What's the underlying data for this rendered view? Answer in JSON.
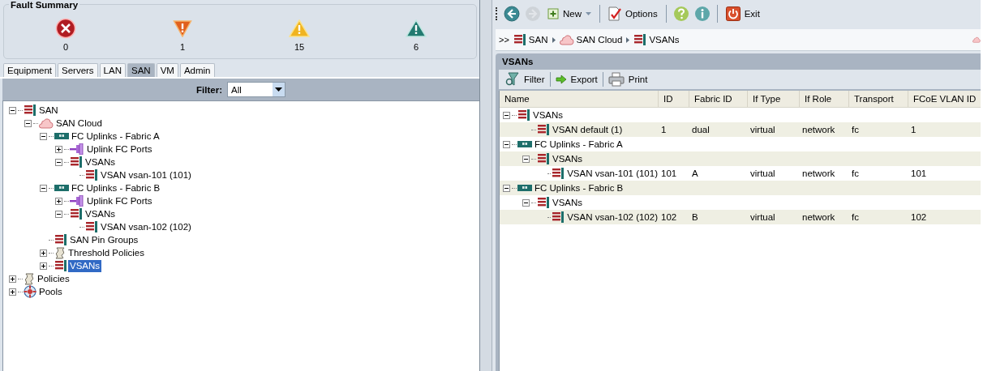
{
  "fault_summary": {
    "title": "Fault Summary",
    "faults": [
      {
        "kind": "critical",
        "count": "0"
      },
      {
        "kind": "major",
        "count": "1"
      },
      {
        "kind": "minor",
        "count": "15"
      },
      {
        "kind": "warning",
        "count": "6"
      }
    ]
  },
  "nav_tabs": [
    {
      "label": "Equipment",
      "selected": false
    },
    {
      "label": "Servers",
      "selected": false
    },
    {
      "label": "LAN",
      "selected": false
    },
    {
      "label": "SAN",
      "selected": true
    },
    {
      "label": "VM",
      "selected": false
    },
    {
      "label": "Admin",
      "selected": false
    }
  ],
  "filter": {
    "label": "Filter:",
    "value": "All"
  },
  "tree": [
    {
      "label": "SAN",
      "kind": "vsan",
      "expanded": true,
      "selected": false,
      "children": [
        {
          "label": "SAN Cloud",
          "kind": "cloud",
          "expanded": true,
          "selected": false,
          "children": [
            {
              "label": "FC Uplinks - Fabric A",
              "kind": "uplink",
              "expanded": true,
              "selected": false,
              "children": [
                {
                  "label": "Uplink FC Ports",
                  "kind": "port",
                  "expanded": false,
                  "selected": false
                },
                {
                  "label": "VSANs",
                  "kind": "vsan",
                  "expanded": true,
                  "selected": false,
                  "children": [
                    {
                      "label": "VSAN vsan-101 (101)",
                      "kind": "vsan",
                      "selected": false
                    }
                  ]
                }
              ]
            },
            {
              "label": "FC Uplinks - Fabric B",
              "kind": "uplink",
              "expanded": true,
              "selected": false,
              "children": [
                {
                  "label": "Uplink FC Ports",
                  "kind": "port",
                  "expanded": false,
                  "selected": false
                },
                {
                  "label": "VSANs",
                  "kind": "vsan",
                  "expanded": true,
                  "selected": false,
                  "children": [
                    {
                      "label": "VSAN vsan-102 (102)",
                      "kind": "vsan",
                      "selected": false
                    }
                  ]
                }
              ]
            },
            {
              "label": "SAN Pin Groups",
              "kind": "vsan",
              "selected": false
            },
            {
              "label": "Threshold Policies",
              "kind": "policy",
              "expanded": false,
              "selected": false
            },
            {
              "label": "VSANs",
              "kind": "vsan",
              "expanded": false,
              "selected": true
            }
          ]
        }
      ]
    },
    {
      "label": "Policies",
      "kind": "policy",
      "expanded": false,
      "selected": false
    },
    {
      "label": "Pools",
      "kind": "pool",
      "expanded": false,
      "selected": false
    }
  ],
  "toolbar": [
    {
      "kind": "back",
      "disabled": false
    },
    {
      "kind": "forward",
      "disabled": true
    },
    {
      "kind": "new",
      "label": "New",
      "dropdown": true,
      "disabled": false
    },
    {
      "kind": "separator"
    },
    {
      "kind": "options",
      "label": "Options",
      "dropdown": false,
      "disabled": false
    },
    {
      "kind": "separator"
    },
    {
      "kind": "help",
      "disabled": false
    },
    {
      "kind": "info",
      "disabled": false
    },
    {
      "kind": "separator"
    },
    {
      "kind": "exit",
      "label": "Exit",
      "dropdown": false,
      "disabled": false
    }
  ],
  "breadcrumb": {
    "prefix": ">>",
    "items": [
      {
        "kind": "vsan",
        "label": "SAN"
      },
      {
        "kind": "cloud",
        "label": "SAN Cloud"
      },
      {
        "kind": "vsan",
        "label": "VSANs"
      }
    ]
  },
  "panel": {
    "title": "VSANs",
    "actions": [
      {
        "kind": "filter",
        "label": "Filter"
      },
      {
        "kind": "export",
        "label": "Export"
      },
      {
        "kind": "print",
        "label": "Print"
      }
    ],
    "table": {
      "columns": [
        "Name",
        "ID",
        "Fabric ID",
        "If Type",
        "If Role",
        "Transport",
        "FCoE VLAN ID"
      ],
      "rows": [
        {
          "name": "VSANs",
          "kind": "vsan",
          "expanded": true,
          "children": [
            {
              "name": "VSAN default (1)",
              "kind": "vsan",
              "cells": [
                "1",
                "dual",
                "virtual",
                "network",
                "fc",
                "1"
              ]
            }
          ]
        },
        {
          "name": "FC Uplinks - Fabric A",
          "kind": "uplink",
          "expanded": true,
          "children": [
            {
              "name": "VSANs",
              "kind": "vsan",
              "expanded": true,
              "children": [
                {
                  "name": "VSAN vsan-101 (101)",
                  "kind": "vsan",
                  "cells": [
                    "101",
                    "A",
                    "virtual",
                    "network",
                    "fc",
                    "101"
                  ]
                }
              ]
            }
          ]
        },
        {
          "name": "FC Uplinks - Fabric B",
          "kind": "uplink",
          "expanded": true,
          "children": [
            {
              "name": "VSANs",
              "kind": "vsan",
              "expanded": true,
              "children": [
                {
                  "name": "VSAN vsan-102 (102)",
                  "kind": "vsan",
                  "cells": [
                    "102",
                    "B",
                    "virtual",
                    "network",
                    "fc",
                    "102"
                  ]
                }
              ]
            }
          ]
        }
      ]
    }
  }
}
